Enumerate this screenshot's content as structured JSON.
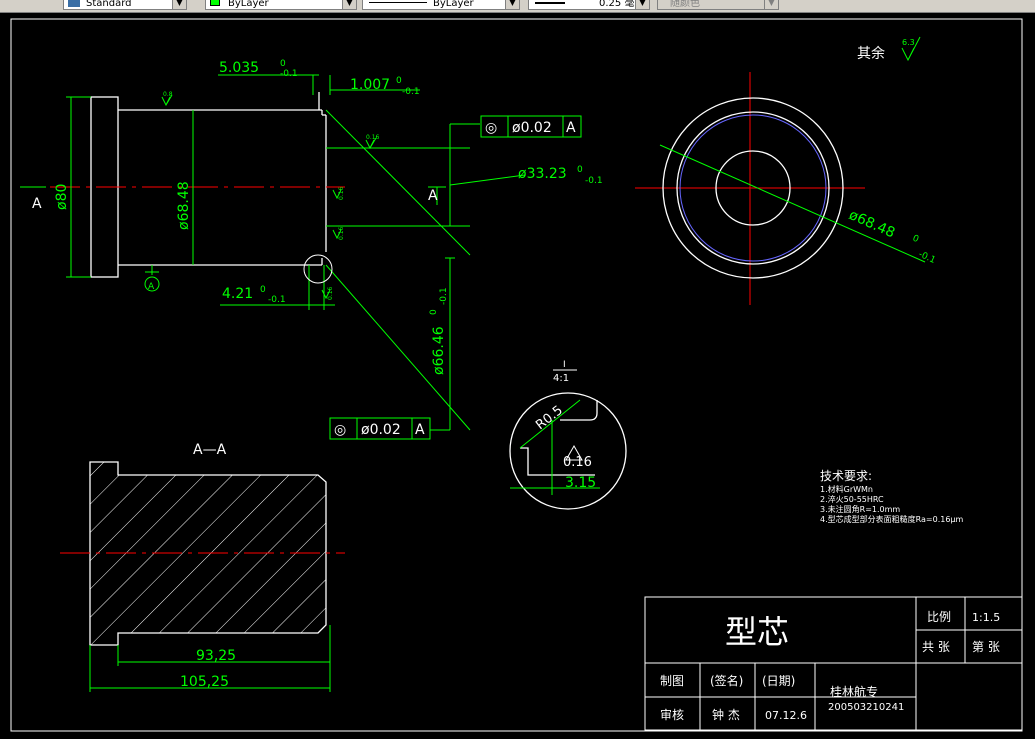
{
  "toolbar": {
    "text_style": "Standard",
    "layer_color": "ByLayer",
    "linetype": "ByLayer",
    "lineweight": "0.25 毫米",
    "plot_style": "随颜色"
  },
  "drawing": {
    "dims": {
      "top_left": "5.035",
      "top_left_tol": "0",
      "top_left_tol2": "-0.1",
      "top_right": "1.007",
      "top_right_tol": "0",
      "top_right_tol2": "-0.1",
      "dia80": "ø80",
      "dia68": "ø68.48",
      "dia33": "ø33.23",
      "dia33_tol": "0",
      "dia33_tol2": "-0.1",
      "bottom_left": "4.21",
      "bottom_left_tol": "0",
      "bottom_left_tol2": "-0.1",
      "dia66": "ø66.46",
      "dia66_tol": "0",
      "dia66_tol2": "-0.1",
      "circle_dia": "ø68.48",
      "circle_tol": "0",
      "circle_tol2": "-0.1",
      "len93": "93,25",
      "len105": "105,25",
      "r05": "R0.5",
      "d316": "0.16",
      "d315": "3.15"
    },
    "tolerance_box_1": {
      "symbol": "◎",
      "value": "ø0.02",
      "datum": "A"
    },
    "tolerance_box_2": {
      "symbol": "◎",
      "value": "ø0.02",
      "datum": "A"
    },
    "roughness_rest": "其余",
    "roughness_rest_val": "6.3",
    "section_label": "A—A",
    "view_arrow_left": "A",
    "view_arrow_mid": "A",
    "datum_A": "A",
    "detail_scale_top": "I",
    "detail_scale": "4:1",
    "small_roughness": [
      "0.8",
      "0.16",
      "0.16",
      "0.16",
      "0.16"
    ],
    "tech": {
      "title": "技术要求:",
      "items": [
        "1.材料GrWMn",
        "2.淬火50-55HRC",
        "3.未注圆角R=1.0mm",
        "4.型芯成型部分表面粗糙度Ra=0.16μm"
      ]
    }
  },
  "title_block": {
    "part_name": "型芯",
    "scale_label": "比例",
    "scale_value": "1:1.5",
    "sheets_total": "共  张",
    "sheet_no": "第  张",
    "drawn_label": "制图",
    "sign_label": "(签名)",
    "date_label": "(日期)",
    "check_label": "审核",
    "checker": "钟  杰",
    "date": "07.12.6",
    "school": "桂林航专",
    "number": "200503210241"
  }
}
